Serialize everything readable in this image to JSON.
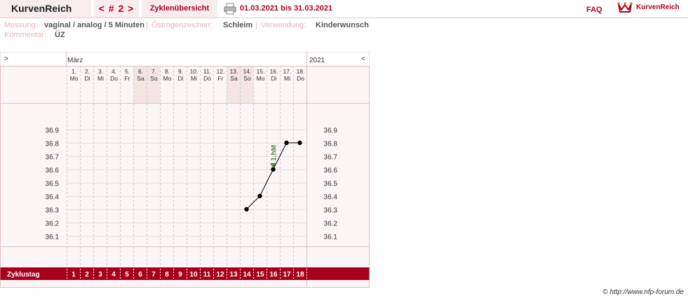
{
  "header": {
    "brand": "KurvenReich",
    "cycle_nav": "< # 2 >",
    "overview_tab": "Zyklenübersicht",
    "date_range": "01.03.2021 bis 31.03.2021",
    "faq": "FAQ",
    "logo_text": "KurvenReich",
    "accent_color": "#b00020"
  },
  "info": {
    "messung_label": "Messung:",
    "messung_value": "vaginal / analog / 5 Minuten",
    "oestrogen_label": "Östrogenzeichen:",
    "oestrogen_value": "Schleim",
    "verwendung_label": "Verwendung:",
    "verwendung_value": "Kinderwunsch",
    "kommentar_label": "Kommentar:",
    "kommentar_value": "ÜZ"
  },
  "chart_header": {
    "nav_left": ">",
    "month": "März",
    "year": "2021",
    "nav_right": "<"
  },
  "footer": {
    "credit": "© http://www.nfp-forum.de"
  },
  "chart_data": {
    "type": "line",
    "days": [
      {
        "date": "1.",
        "weekday": "Mo",
        "cycle_day": 1,
        "weekend": false
      },
      {
        "date": "2.",
        "weekday": "Di",
        "cycle_day": 2,
        "weekend": false
      },
      {
        "date": "3.",
        "weekday": "Mi",
        "cycle_day": 3,
        "weekend": false
      },
      {
        "date": "4.",
        "weekday": "Do",
        "cycle_day": 4,
        "weekend": false
      },
      {
        "date": "5.",
        "weekday": "Fr",
        "cycle_day": 5,
        "weekend": false
      },
      {
        "date": "6.",
        "weekday": "Sa",
        "cycle_day": 6,
        "weekend": true
      },
      {
        "date": "7.",
        "weekday": "So",
        "cycle_day": 7,
        "weekend": true
      },
      {
        "date": "8.",
        "weekday": "Mo",
        "cycle_day": 8,
        "weekend": false
      },
      {
        "date": "9.",
        "weekday": "Di",
        "cycle_day": 9,
        "weekend": false
      },
      {
        "date": "10.",
        "weekday": "Mi",
        "cycle_day": 10,
        "weekend": false
      },
      {
        "date": "11.",
        "weekday": "Do",
        "cycle_day": 11,
        "weekend": false
      },
      {
        "date": "12.",
        "weekday": "Fr",
        "cycle_day": 12,
        "weekend": false
      },
      {
        "date": "13.",
        "weekday": "Sa",
        "cycle_day": 13,
        "weekend": true
      },
      {
        "date": "14.",
        "weekday": "So",
        "cycle_day": 14,
        "weekend": true
      },
      {
        "date": "15.",
        "weekday": "Mo",
        "cycle_day": 15,
        "weekend": false
      },
      {
        "date": "16.",
        "weekday": "Di",
        "cycle_day": 16,
        "weekend": false
      },
      {
        "date": "17.",
        "weekday": "Mi",
        "cycle_day": 17,
        "weekend": false
      },
      {
        "date": "18.",
        "weekday": "Do",
        "cycle_day": 18,
        "weekend": false
      }
    ],
    "y_ticks": [
      36.9,
      36.8,
      36.7,
      36.6,
      36.5,
      36.4,
      36.3,
      36.2,
      36.1
    ],
    "ylim": [
      36.1,
      36.9
    ],
    "series": [
      {
        "points": [
          {
            "cycle_day": 14,
            "temp": 36.3
          },
          {
            "cycle_day": 15,
            "temp": 36.4
          },
          {
            "cycle_day": 16,
            "temp": 36.6
          },
          {
            "cycle_day": 17,
            "temp": 36.8
          },
          {
            "cycle_day": 18,
            "temp": 36.8
          }
        ],
        "line_color": "#000000"
      }
    ],
    "marker": {
      "cycle_day": 16,
      "temp": 36.6,
      "label": "1.hM",
      "color": "#5a8a3a"
    },
    "row_label": "Zyklustag",
    "row_color": "#a8001c",
    "weekend_color": "#f4e4e4"
  }
}
